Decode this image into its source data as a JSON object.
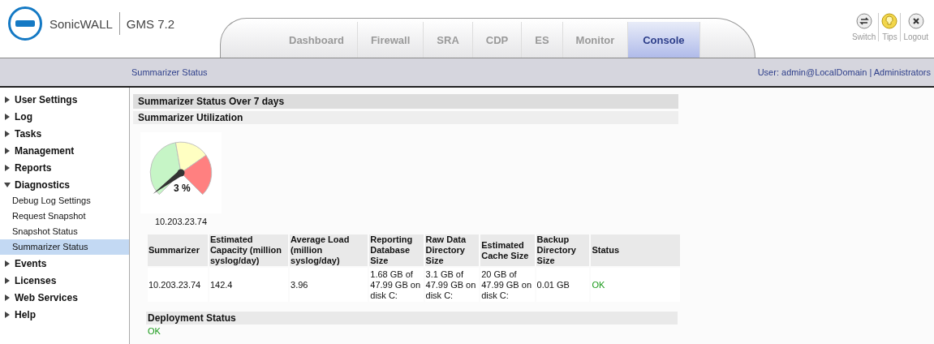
{
  "header": {
    "brand": "SonicWALL",
    "product": "GMS 7.2"
  },
  "tabs": [
    {
      "label": "Dashboard",
      "selected": false
    },
    {
      "label": "Firewall",
      "selected": false
    },
    {
      "label": "SRA",
      "selected": false
    },
    {
      "label": "CDP",
      "selected": false
    },
    {
      "label": "ES",
      "selected": false
    },
    {
      "label": "Monitor",
      "selected": false
    },
    {
      "label": "Console",
      "selected": true
    }
  ],
  "actions": [
    {
      "kind": "switch",
      "label": "Switch"
    },
    {
      "kind": "tips",
      "label": "Tips"
    },
    {
      "kind": "logout",
      "label": "Logout"
    }
  ],
  "breadcrumb": "Summarizer Status",
  "user": "User: admin@LocalDomain | Administrators",
  "sidebar": {
    "items": [
      {
        "label": "User Settings",
        "expanded": false
      },
      {
        "label": "Log",
        "expanded": false
      },
      {
        "label": "Tasks",
        "expanded": false
      },
      {
        "label": "Management",
        "expanded": false
      },
      {
        "label": "Reports",
        "expanded": false
      },
      {
        "label": "Diagnostics",
        "expanded": true,
        "children": [
          {
            "label": "Debug Log Settings",
            "selected": false
          },
          {
            "label": "Request Snapshot",
            "selected": false
          },
          {
            "label": "Snapshot Status",
            "selected": false
          },
          {
            "label": "Summarizer Status",
            "selected": true
          }
        ]
      },
      {
        "label": "Events",
        "expanded": false
      },
      {
        "label": "Licenses",
        "expanded": false
      },
      {
        "label": "Web Services",
        "expanded": false
      },
      {
        "label": "Help",
        "expanded": false
      }
    ]
  },
  "panel": {
    "title": "Summarizer Status Over 7 days",
    "subtitle": "Summarizer Utilization",
    "gauge": {
      "reading": "3 %",
      "host": "10.203.23.74"
    },
    "table": {
      "columns": [
        "Summarizer",
        "Estimated Capacity (million syslog/day)",
        "Average Load (million syslog/day)",
        "Reporting Database Size",
        "Raw Data Directory Size",
        "Estimated Cache Size",
        "Backup Directory Size",
        "Status"
      ],
      "rows": [
        [
          "10.203.23.74",
          "142.4",
          "3.96",
          "1.68 GB of 47.99 GB on disk C:",
          "3.1 GB of 47.99 GB on disk C:",
          "20 GB of 47.99 GB on disk C:",
          "0.01 GB",
          "OK"
        ]
      ]
    },
    "deployment": {
      "title": "Deployment Status",
      "status": "OK"
    }
  }
}
